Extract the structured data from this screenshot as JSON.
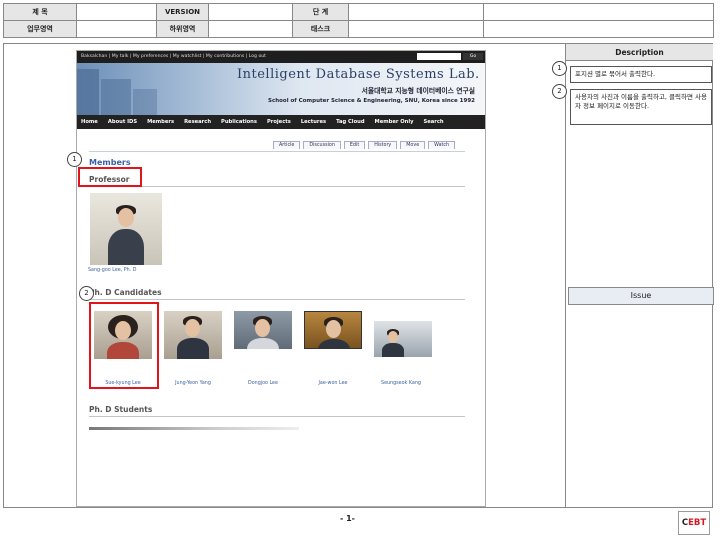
{
  "header": {
    "title_label": "제 목",
    "version_label": "VERSION",
    "stage_label": "단 계",
    "work_area_label": "업무영역",
    "sub_area_label": "하위영역",
    "task_label": "태스크"
  },
  "site": {
    "topbar_links": "Baksalchan | My talk | My preferences | My watchlist | My contributions | Log out",
    "go_label": "Go",
    "title": "Intelligent Database Systems Lab.",
    "korean_name": "서울대학교 지능형 데이터베이스 연구실",
    "school": "School of Computer Science & Engineering, SNU, Korea since 1992",
    "nav": [
      "Home",
      "About IDS",
      "Members",
      "Research",
      "Publications",
      "Projects",
      "Lectures",
      "Tag Cloud",
      "Member Only",
      "Search"
    ],
    "tabs": [
      "Article",
      "Discussion",
      "Edit",
      "History",
      "Move",
      "Watch"
    ],
    "members_heading": "Members",
    "professor_heading": "Professor",
    "professor_name": "Sang-goo Lee, Ph. D",
    "phd_candidates_heading": "Ph. D Candidates",
    "candidates": [
      "Sue-kyung Lee",
      "Jung-Yeon Yang",
      "Dongjoo Lee",
      "Jae-won Lee",
      "Seungseok Kang"
    ],
    "phd_students_heading": "Ph. D Students"
  },
  "markers": [
    "1",
    "2"
  ],
  "description": {
    "heading": "Description",
    "items": [
      {
        "num": "1",
        "text": "포지션 별로 묶어서 출력한다."
      },
      {
        "num": "2",
        "text": "사용자의 사진과 이름을 출력하고, 클릭하면 사용자 정보 페이지로 이동한다."
      }
    ],
    "issue_heading": "Issue"
  },
  "footer": {
    "page_number": "- 1-",
    "logo_prefix": "C",
    "logo_accent": "EBT"
  },
  "colors": {
    "highlight": "#e2141a",
    "link": "#3b5fa4",
    "nav_bg": "#222222"
  }
}
